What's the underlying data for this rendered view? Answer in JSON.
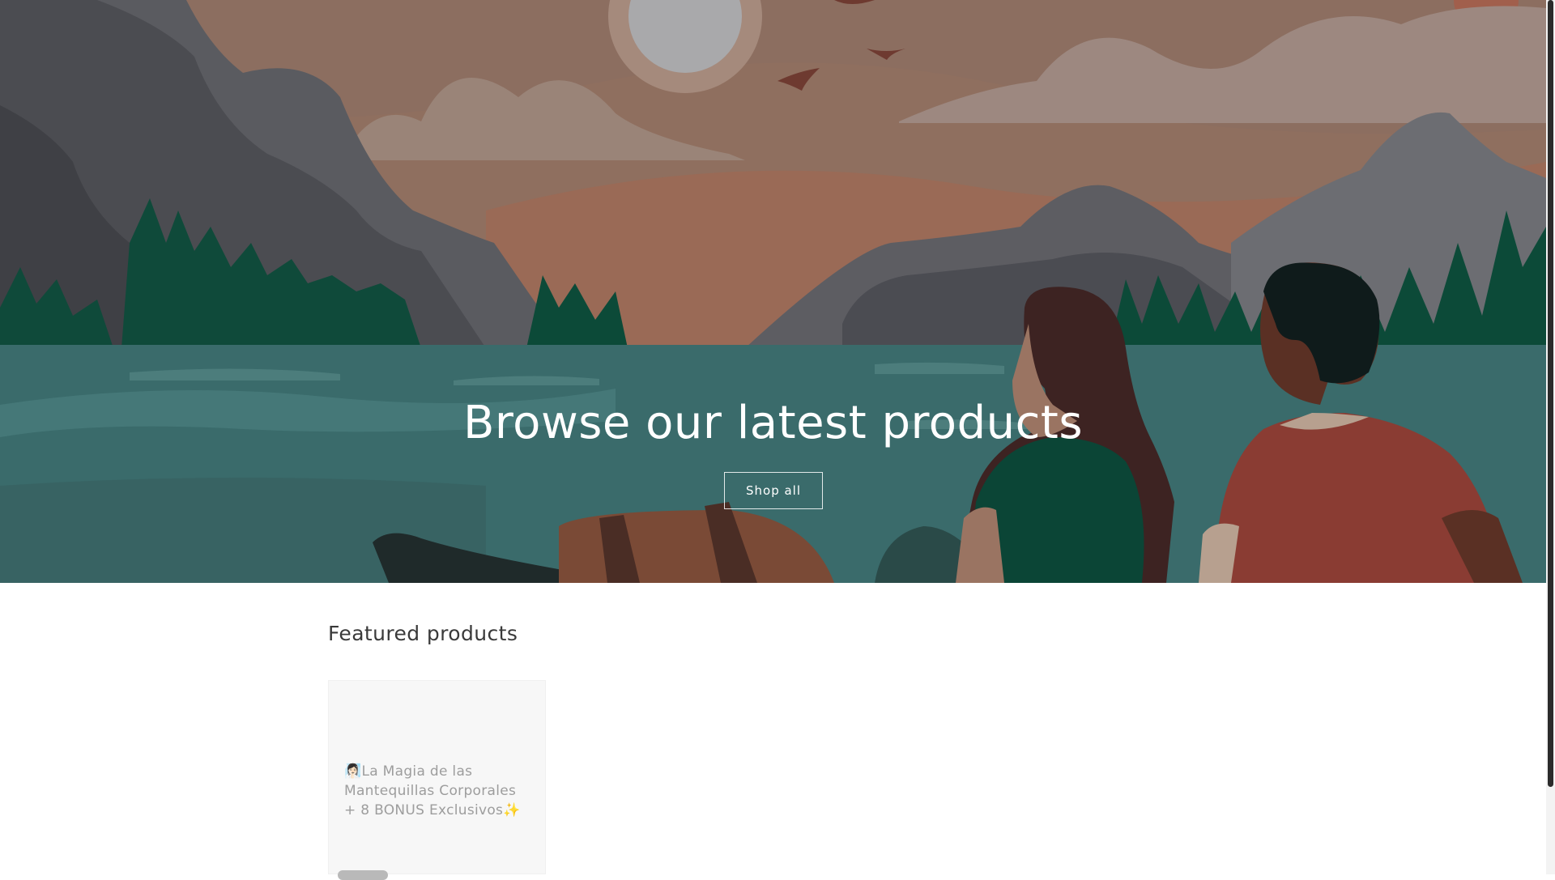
{
  "hero": {
    "title": "Browse our latest products",
    "button_label": "Shop all"
  },
  "featured": {
    "heading": "Featured products",
    "products": [
      {
        "title": "🧖🏻‍♀️La Magia de las Mantequillas Corporales + 8 BONUS Exclusivos✨"
      }
    ]
  },
  "colors": {
    "sky": "#8f6f5f",
    "water": "#3a6b6b",
    "mountain": "#4e5056",
    "tree": "#0f4a3a"
  }
}
